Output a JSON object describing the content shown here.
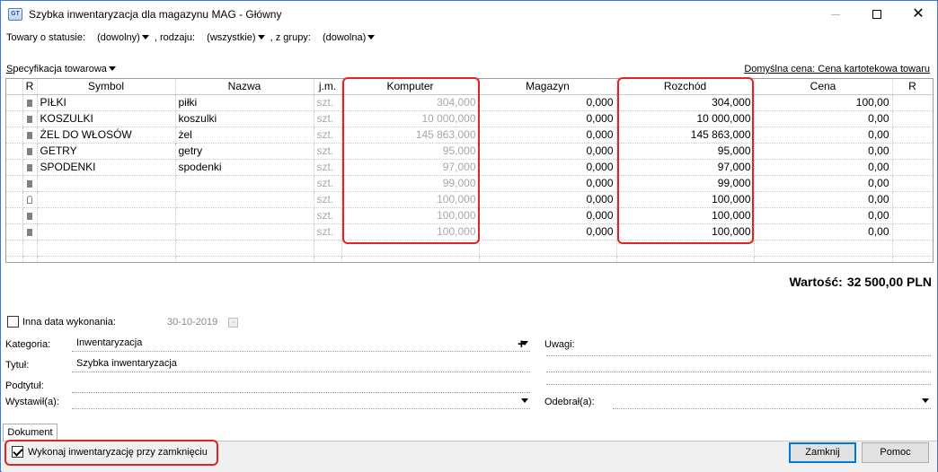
{
  "window": {
    "title": "Szybka inwentaryzacja dla magazynu MAG - Główny",
    "icon_text": "GT",
    "close_symbol": "✕"
  },
  "filters": {
    "status_label": "Towary o statusie:",
    "status_value": "(dowolny)",
    "type_label": ", rodzaju:",
    "type_value": "(wszystkie)",
    "group_label": ", z grupy:",
    "group_value": "(dowolna)"
  },
  "spec": {
    "label_first": "S",
    "label_rest": "pecyfikacja towarowa",
    "default_price": "Domyślna cena: Cena kartotekowa towaru"
  },
  "table": {
    "headers": {
      "r": "R",
      "symbol": "Symbol",
      "name": "Nazwa",
      "unit": "j.m.",
      "computer": "Komputer",
      "warehouse": "Magazyn",
      "outflow": "Rozchód",
      "price": "Cena",
      "r2": "R"
    },
    "rows": [
      {
        "marker": "square",
        "symbol": "PIŁKI",
        "name": "piłki",
        "unit": "szt.",
        "computer": "304,000",
        "warehouse": "0,000",
        "outflow": "304,000",
        "price": "100,00"
      },
      {
        "marker": "square",
        "symbol": "KOSZULKI",
        "name": "koszulki",
        "unit": "szt.",
        "computer": "10 000,000",
        "warehouse": "0,000",
        "outflow": "10 000,000",
        "price": "0,00"
      },
      {
        "marker": "square",
        "symbol": "ŻEL DO WŁOSÓW",
        "name": "żel",
        "unit": "szt.",
        "computer": "145 863,000",
        "warehouse": "0,000",
        "outflow": "145 863,000",
        "price": "0,00"
      },
      {
        "marker": "square",
        "symbol": "GETRY",
        "name": "getry",
        "unit": "szt.",
        "computer": "95,000",
        "warehouse": "0,000",
        "outflow": "95,000",
        "price": "0,00"
      },
      {
        "marker": "square",
        "symbol": "SPODENKI",
        "name": "spodenki",
        "unit": "szt.",
        "computer": "97,000",
        "warehouse": "0,000",
        "outflow": "97,000",
        "price": "0,00"
      },
      {
        "marker": "square",
        "symbol": "",
        "name": "",
        "unit": "szt.",
        "computer": "99,000",
        "warehouse": "0,000",
        "outflow": "99,000",
        "price": "0,00"
      },
      {
        "marker": "lock",
        "symbol": "",
        "name": "",
        "unit": "szt.",
        "computer": "100,000",
        "warehouse": "0,000",
        "outflow": "100,000",
        "price": "0,00"
      },
      {
        "marker": "square",
        "symbol": "",
        "name": "",
        "unit": "szt.",
        "computer": "100,000",
        "warehouse": "0,000",
        "outflow": "100,000",
        "price": "0,00"
      },
      {
        "marker": "square",
        "symbol": "",
        "name": "",
        "unit": "szt.",
        "computer": "100,000",
        "warehouse": "0,000",
        "outflow": "100,000",
        "price": "0,00"
      }
    ]
  },
  "total": {
    "label": "Wartość:",
    "value": "32 500,00 PLN"
  },
  "form": {
    "other_date_label": "Inna data wykonania:",
    "other_date_checked": false,
    "date_value": "30-10-2019",
    "category_label": "Kategoria:",
    "category_value": "Inwentaryzacja",
    "plus_symbol": "+",
    "title_label": "Tytuł:",
    "title_value": "Szybka inwentaryzacja",
    "subtitle_label": "Podtytuł:",
    "subtitle_value": "",
    "issued_label": "Wystawił(a):",
    "issued_value": "",
    "notes_label": "Uwagi:",
    "received_label": "Odebrał(a):",
    "received_value": ""
  },
  "tabs": {
    "document": "Dokument"
  },
  "footer": {
    "execute_label": "Wykonaj inwentaryzację przy zamknięciu",
    "execute_checked": true,
    "close_button": "Zamknij",
    "help_button": "Pomoc"
  },
  "colors": {
    "highlight": "#e52222",
    "accent": "#0078d7"
  }
}
